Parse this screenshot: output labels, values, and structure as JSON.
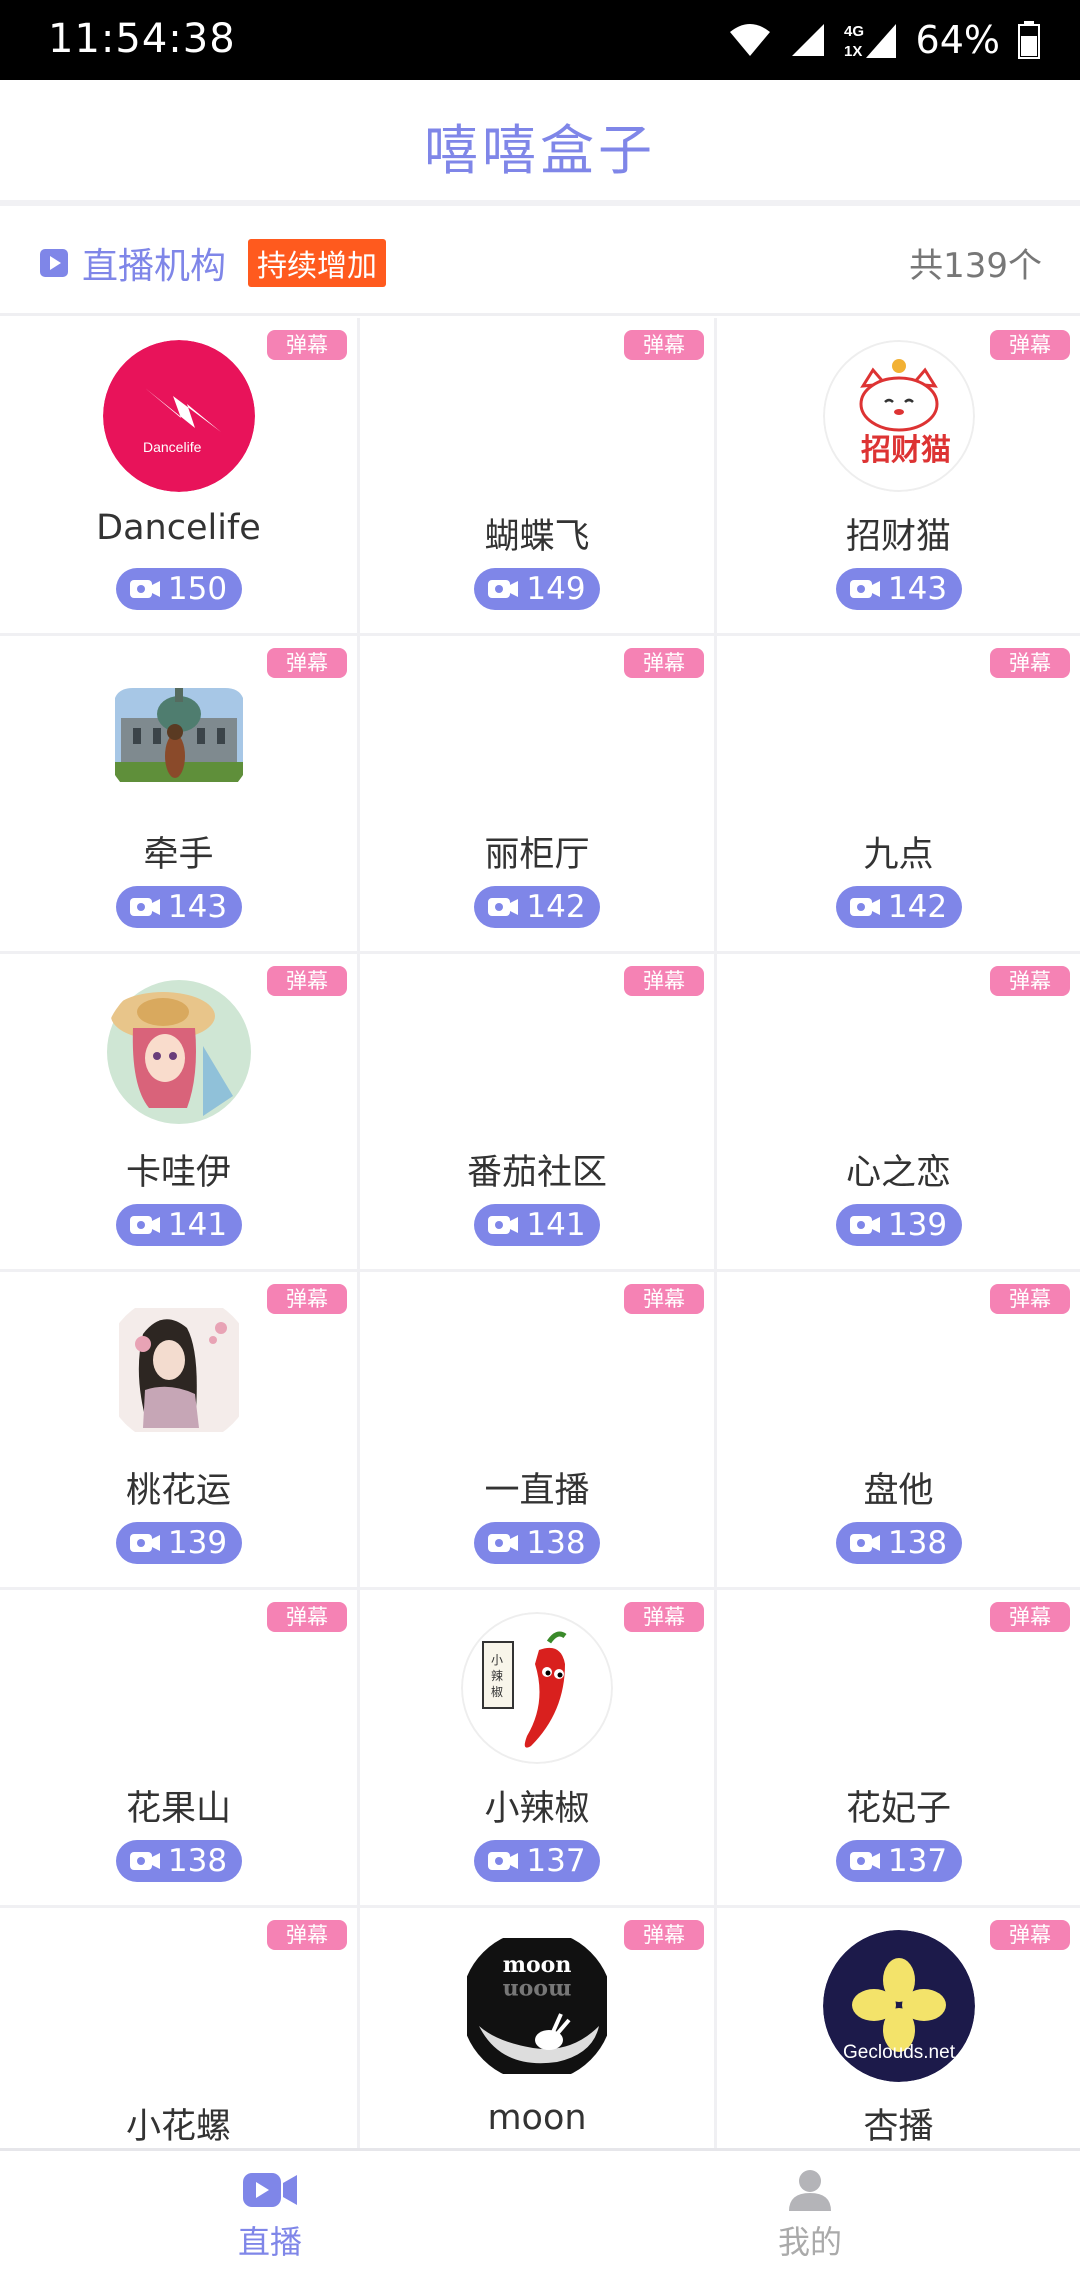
{
  "status_bar": {
    "time": "11:54:38",
    "network": "4G 1X",
    "battery": "64%"
  },
  "app": {
    "title": "嘻嘻盒子"
  },
  "section": {
    "title": "直播机构",
    "tag": "持续增加",
    "count": "共139个"
  },
  "badge_label": "弹幕",
  "platforms": [
    {
      "name": "Dancelife",
      "count": "150",
      "avatar": "dancelife-logo"
    },
    {
      "name": "蝴蝶飞",
      "count": "149",
      "avatar": ""
    },
    {
      "name": "招财猫",
      "count": "143",
      "avatar": "lucky-cat-logo"
    },
    {
      "name": "牵手",
      "count": "143",
      "avatar": "castle-photo"
    },
    {
      "name": "丽柜厅",
      "count": "142",
      "avatar": ""
    },
    {
      "name": "九点",
      "count": "142",
      "avatar": ""
    },
    {
      "name": "卡哇伊",
      "count": "141",
      "avatar": "anime-girl"
    },
    {
      "name": "番茄社区",
      "count": "141",
      "avatar": ""
    },
    {
      "name": "心之恋",
      "count": "139",
      "avatar": ""
    },
    {
      "name": "桃花运",
      "count": "139",
      "avatar": "painted-lady"
    },
    {
      "name": "一直播",
      "count": "138",
      "avatar": ""
    },
    {
      "name": "盘他",
      "count": "138",
      "avatar": ""
    },
    {
      "name": "花果山",
      "count": "138",
      "avatar": ""
    },
    {
      "name": "小辣椒",
      "count": "137",
      "avatar": "chili-pepper"
    },
    {
      "name": "花妃子",
      "count": "137",
      "avatar": ""
    },
    {
      "name": "小花螺",
      "count": "",
      "avatar": ""
    },
    {
      "name": "moon",
      "count": "",
      "avatar": "moon-rabbit",
      "avatar_text": "moon"
    },
    {
      "name": "杏播",
      "count": "",
      "avatar": "clover-logo",
      "avatar_text": "Geclouds.net"
    }
  ],
  "bottom_nav": {
    "live": "直播",
    "mine": "我的"
  },
  "colors": {
    "accent": "#7f86e8",
    "tag": "#ff5a1e",
    "danmu_badge": "#f582b4"
  }
}
